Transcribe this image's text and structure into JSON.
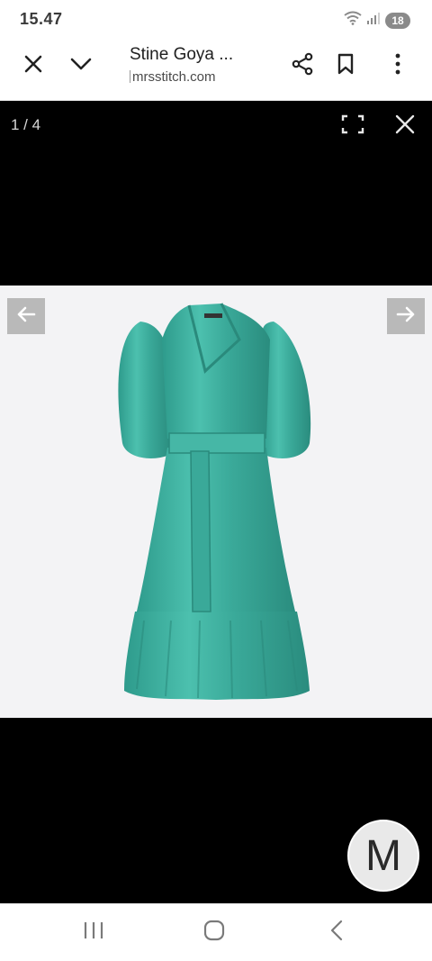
{
  "status": {
    "time": "15.47",
    "battery": "18",
    "icons": [
      "wifi-icon",
      "signal-icon",
      "battery-icon"
    ]
  },
  "toolbar": {
    "title": "Stine Goya ...",
    "url": "mrsstitch.com",
    "icons": [
      "close-icon",
      "chevron-down-icon",
      "share-icon",
      "bookmark-icon",
      "more-vert-icon"
    ]
  },
  "viewer": {
    "counter": "1 / 4",
    "avatar_letter": "M",
    "icons": [
      "fullscreen-icon",
      "close-icon",
      "arrow-left-icon",
      "arrow-right-icon"
    ]
  },
  "colors": {
    "viewer_bg": "#000000",
    "image_bg": "#f3f3f5",
    "dress": "#3fb0a0",
    "dress_shade": "#2a8f80",
    "nav_arrow_bg": "#b9b9b9"
  },
  "nav": {
    "icons": [
      "recent-apps-icon",
      "home-icon",
      "back-icon"
    ]
  }
}
